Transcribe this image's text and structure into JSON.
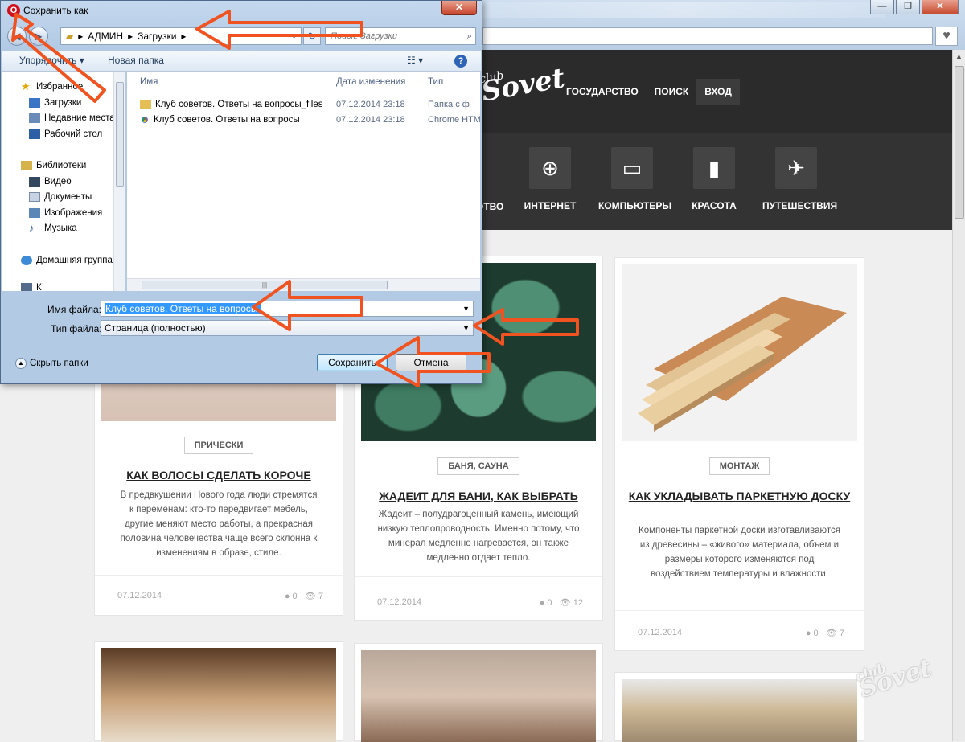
{
  "browser": {
    "window_controls": {
      "minimize": "—",
      "maximize": "❐",
      "close": "✕"
    },
    "heart_icon": "♥"
  },
  "site": {
    "logo_top": "club",
    "logo_main": "Sovet",
    "nav": [
      "ГОСУДАРСТВО",
      "ПОИСК",
      "ВХОД"
    ],
    "categories": [
      {
        "label": "ОТВО",
        "icon": ""
      },
      {
        "label": "ИНТЕРНЕТ",
        "icon": "globe-icon"
      },
      {
        "label": "КОМПЬЮТЕРЫ",
        "icon": "monitor-icon"
      },
      {
        "label": "КРАСОТА",
        "icon": "lipstick-icon"
      },
      {
        "label": "ПУТЕШЕСТВИЯ",
        "icon": "airplane-icon"
      }
    ],
    "cards": [
      {
        "tag": "ПРИЧЕСКИ",
        "title": "КАК ВОЛОСЫ СДЕЛАТЬ КОРОЧЕ",
        "text": "В предвкушении Нового года люди стремятся к переменам: кто-то передвигает мебель, другие меняют место работы, а прекрасная половина человечества чаще всего склонна к изменениям в образе, стиле.",
        "date": "07.12.2014",
        "comments": "0",
        "views": "7"
      },
      {
        "tag": "БАНЯ, САУНА",
        "title": "ЖАДЕИТ ДЛЯ БАНИ, КАК ВЫБРАТЬ",
        "text": "Жадеит – полудрагоценный камень, имеющий низкую теплопроводность. Именно потому, что минерал медленно нагревается, он также медленно отдает тепло.",
        "date": "07.12.2014",
        "comments": "0",
        "views": "12"
      },
      {
        "tag": "МОНТАЖ",
        "title": "КАК УКЛАДЫВАТЬ ПАРКЕТНУЮ ДОСКУ",
        "text": "Компоненты паркетной доски изготавливаются из древесины – «живого» материала, объем и размеры которого изменяются под воздействием температуры и влажности.",
        "date": "07.12.2014",
        "comments": "0",
        "views": "7"
      }
    ],
    "watermark": "Sovet",
    "watermark_small": "club"
  },
  "dialog": {
    "title": "Сохранить как",
    "close": "✕",
    "breadcrumb": [
      "АДМИН",
      "Загрузки"
    ],
    "search_placeholder": "Поиск: Загрузки",
    "toolbar": {
      "organize": "Упорядочить ▾",
      "new_folder": "Новая папка",
      "view": "☷ ▾",
      "help": "?"
    },
    "nav_items": [
      {
        "label": "Избранное",
        "icon": "star-icon",
        "indent": 0
      },
      {
        "label": "Загрузки",
        "icon": "downloads-icon",
        "indent": 1
      },
      {
        "label": "Недавние места",
        "icon": "recent-places-icon",
        "indent": 1
      },
      {
        "label": "Рабочий стол",
        "icon": "desktop-icon",
        "indent": 1
      },
      {
        "label": "Библиотеки",
        "icon": "libraries-icon",
        "indent": 0
      },
      {
        "label": "Видео",
        "icon": "video-icon",
        "indent": 1
      },
      {
        "label": "Документы",
        "icon": "documents-icon",
        "indent": 1
      },
      {
        "label": "Изображения",
        "icon": "images-icon",
        "indent": 1
      },
      {
        "label": "Музыка",
        "icon": "music-icon",
        "indent": 1
      },
      {
        "label": "Домашняя группа",
        "icon": "homegroup-icon",
        "indent": 0
      },
      {
        "label": "К",
        "icon": "computer-icon",
        "indent": 0
      }
    ],
    "columns": [
      "Имя",
      "Дата изменения",
      "Тип"
    ],
    "files": [
      {
        "name": "Клуб советов. Ответы на вопросы_files",
        "date": "07.12.2014 23:18",
        "type": "Папка с ф",
        "icon": "folder-icon"
      },
      {
        "name": "Клуб советов. Ответы на вопросы",
        "date": "07.12.2014 23:18",
        "type": "Chrome HTM",
        "icon": "chrome-icon"
      }
    ],
    "filename_label": "Имя файла:",
    "filename_value": "Клуб советов. Ответы на вопросы.",
    "filetype_label": "Тип файла:",
    "filetype_value": "Страница (полностью)",
    "hide_folders": "Скрыть папки",
    "save": "Сохранить",
    "cancel": "Отмена"
  }
}
